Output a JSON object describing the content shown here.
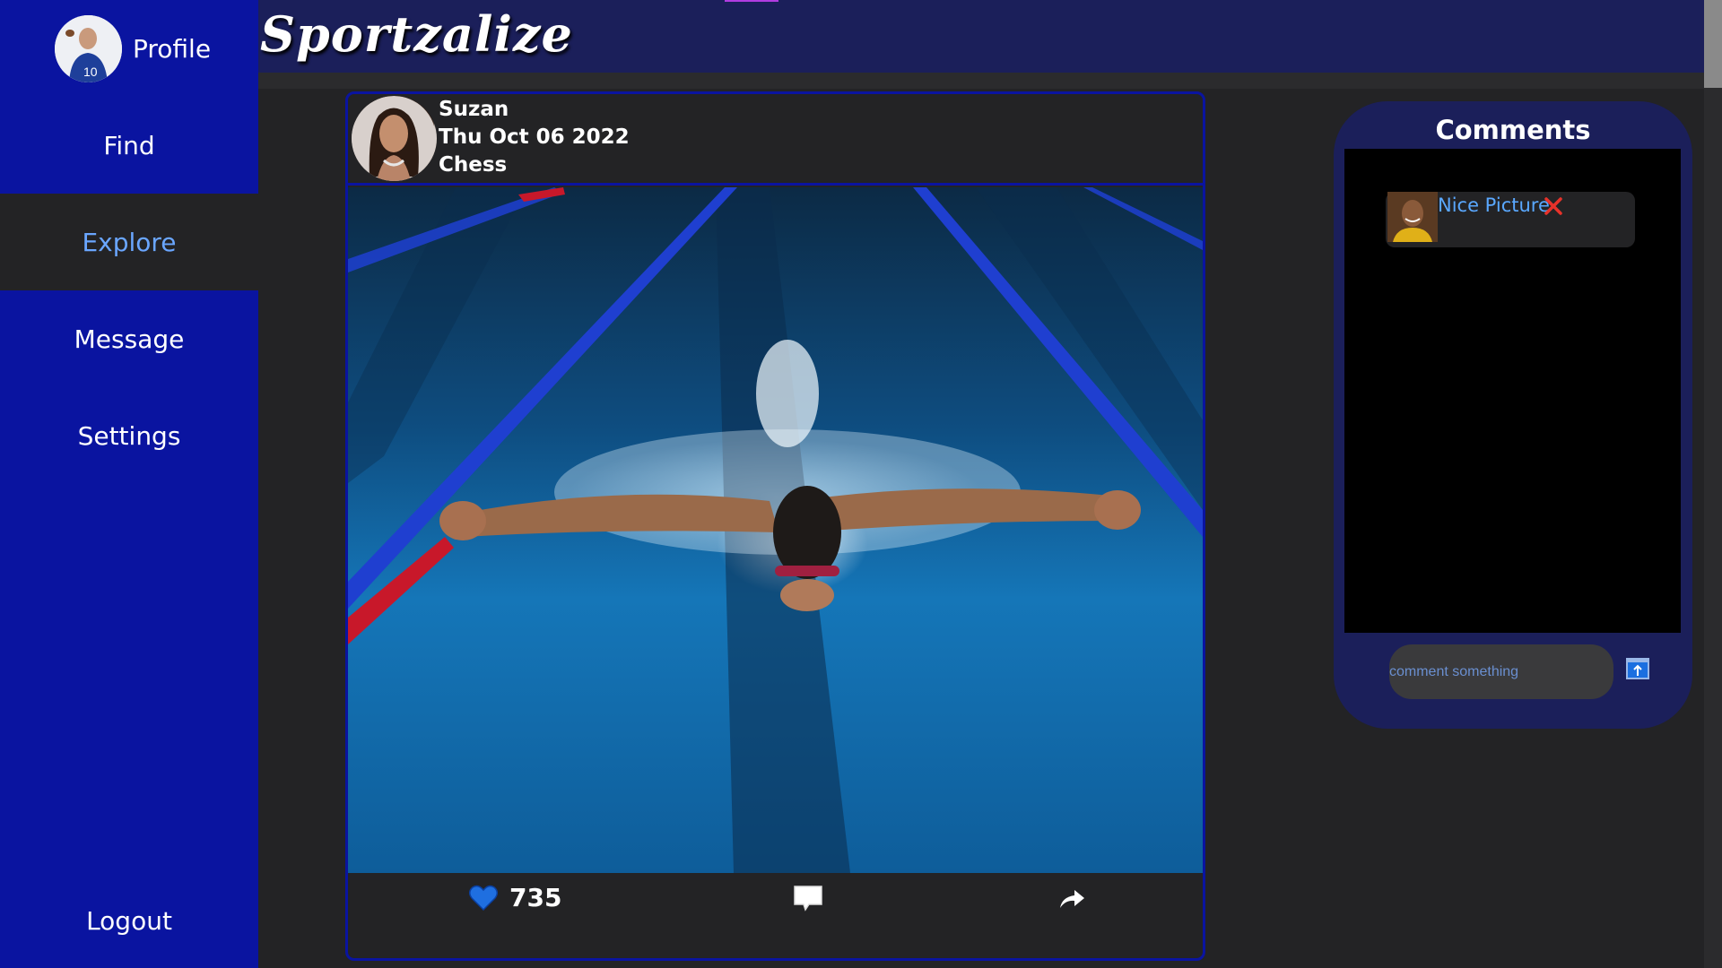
{
  "app": {
    "title": "Sportzalize"
  },
  "sidebar": {
    "profile_label": "Profile",
    "items": [
      {
        "label": "Find"
      },
      {
        "label": "Explore",
        "active": true
      },
      {
        "label": "Message"
      },
      {
        "label": "Settings"
      }
    ],
    "logout_label": "Logout"
  },
  "post": {
    "author": "Suzan",
    "date": "Thu Oct 06 2022",
    "category": "Chess",
    "likes": "735",
    "image_icon": "swimmer-photo"
  },
  "comments": {
    "title": "Comments",
    "items": [
      {
        "text": "Nice Picture"
      }
    ],
    "input_placeholder": "comment something"
  },
  "colors": {
    "sidebar": "#0a14a0",
    "topbar": "#1b1f5a",
    "background": "#232325",
    "accent_text": "#6aa6ff",
    "like": "#1f6fe0",
    "delete": "#e8322a"
  }
}
